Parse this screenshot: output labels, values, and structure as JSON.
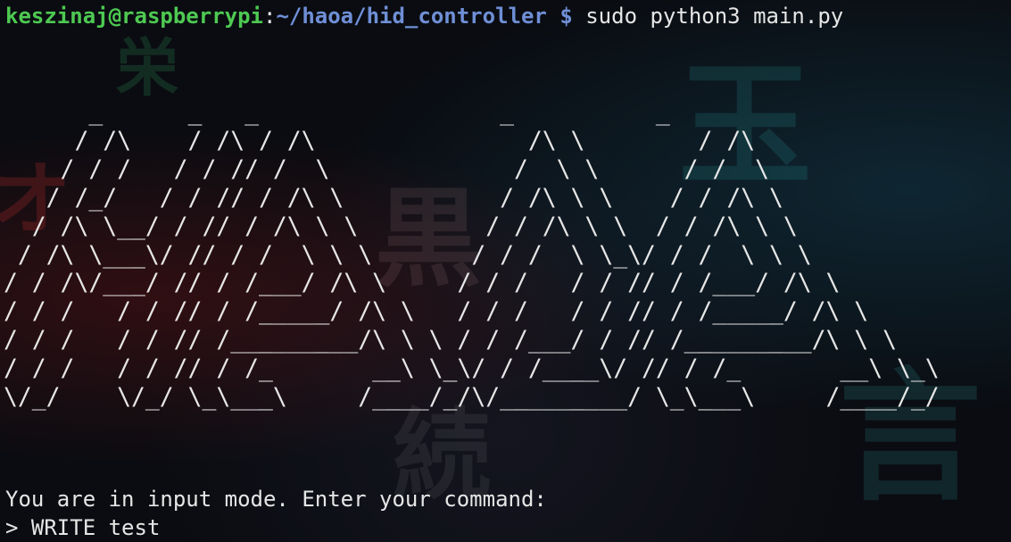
{
  "terminal": {
    "prompt": {
      "user_host": "keszinaj@raspberrypi",
      "colon": ":",
      "cwd": "~/haoa/hid_controller",
      "dollar": "$",
      "command": "sudo python3 main.py"
    },
    "ascii_banner": "      _      _   _                 _          _\n     / /\\    / /\\ / /\\               /\\ \\        / /\\\n    / / /   / / // /  \\             /  \\ \\      / /  \\\n   / /_/   / / // / /\\ \\           / /\\ \\ \\    / / /\\ \\\n  / /\\ \\__/ / // / /\\ \\ \\         / / /\\ \\ \\  / / /\\ \\ \\\n / /\\ \\___\\/ // / /  \\ \\ \\       / / /  \\ \\_\\/ / /  \\ \\ \\\n/ / /\\/___/ // / /___/ /\\ \\     / / /   / / // / /___/ /\\ \\\n/ / /   / / // / /_____/ /\\ \\   / / /   / / // / /_____/ /\\ \\\n/ / /   / / // /_________/\\ \\ \\ / / /___/ / // /_________/\\ \\ \\\n/ / /   / / // / /_       __\\ \\_\\/ / /____\\/ // / /_       __\\ \\_\\\n\\/_/    \\/_/ \\_\\___\\     /____/_/\\/_________/ \\_\\___\\     /____/_/",
    "info_message": "You are in input mode. Enter your command:",
    "input_prompt": ">",
    "input_value": "WRITE test"
  },
  "background": {
    "wallpaper_glyphs": [
      "栄",
      "オ",
      "黒",
      "続",
      "玉",
      "言"
    ],
    "colors": {
      "user_host": "#4ec952",
      "cwd": "#6f8fd6",
      "text": "#e6e6e6",
      "background": "#0a0c11"
    }
  }
}
